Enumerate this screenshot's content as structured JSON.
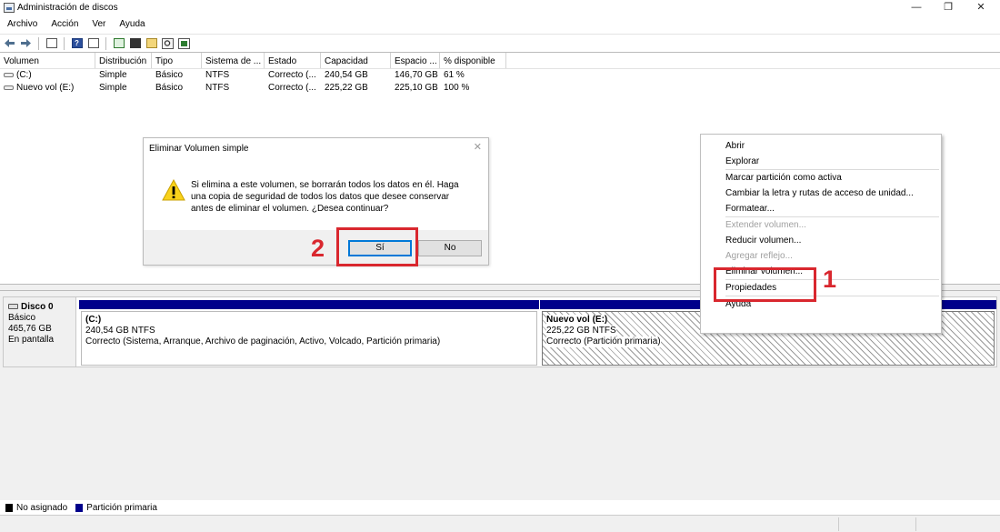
{
  "window": {
    "title": "Administración de discos",
    "minimize": "—",
    "maximize": "❐",
    "close": "✕"
  },
  "menu": [
    "Archivo",
    "Acción",
    "Ver",
    "Ayuda"
  ],
  "toolbar_icons": [
    "back-arrow-icon",
    "forward-arrow-icon",
    "console-tree-icon",
    "help-icon",
    "properties-icon",
    "refresh-icon",
    "disk-icon",
    "open-folder-icon",
    "search-icon",
    "settings-icon"
  ],
  "volume_table": {
    "columns": [
      "Volumen",
      "Distribución",
      "Tipo",
      "Sistema de ...",
      "Estado",
      "Capacidad",
      "Espacio ...",
      "% disponible"
    ],
    "rows": [
      [
        "(C:)",
        "Simple",
        "Básico",
        "NTFS",
        "Correcto (...",
        "240,54 GB",
        "146,70 GB",
        "61 %"
      ],
      [
        "Nuevo vol (E:)",
        "Simple",
        "Básico",
        "NTFS",
        "Correcto (...",
        "225,22 GB",
        "225,10 GB",
        "100 %"
      ]
    ]
  },
  "disk": {
    "name": "Disco 0",
    "type": "Básico",
    "size": "465,76 GB",
    "status": "En pantalla",
    "partitions": [
      {
        "name": "(C:)",
        "size": "240,54 GB NTFS",
        "status": "Correcto (Sistema, Arranque, Archivo de paginación, Activo, Volcado, Partición primaria)"
      },
      {
        "name": "Nuevo vol  (E:)",
        "size": "225,22 GB NTFS",
        "status": "Correcto (Partición primaria)"
      }
    ]
  },
  "legend": {
    "unassigned": "No asignado",
    "primary": "Partición primaria",
    "colors": {
      "unassigned": "#000000",
      "primary": "#00008b"
    }
  },
  "dialog": {
    "title": "Eliminar Volumen simple",
    "message": "Si elimina a este volumen, se borrarán todos los datos en él. Haga una copia de seguridad de todos los datos que desee conservar antes de eliminar el volumen. ¿Desea continuar?",
    "yes": "Sí",
    "no": "No",
    "close": "✕"
  },
  "context_menu": {
    "items": [
      {
        "label": "Abrir",
        "enabled": true
      },
      {
        "label": "Explorar",
        "enabled": true
      },
      {
        "label": "Marcar partición como activa",
        "enabled": true
      },
      {
        "label": "Cambiar la letra y rutas de acceso de unidad...",
        "enabled": true
      },
      {
        "label": "Formatear...",
        "enabled": true
      },
      {
        "label": "Extender volumen...",
        "enabled": false
      },
      {
        "label": "Reducir volumen...",
        "enabled": true
      },
      {
        "label": "Agregar reflejo...",
        "enabled": false
      },
      {
        "label": "Eliminar volumen...",
        "enabled": true
      },
      {
        "label": "Propiedades",
        "enabled": true
      },
      {
        "label": "Ayuda",
        "enabled": true
      }
    ]
  },
  "annotations": {
    "step1": "1",
    "step2": "2",
    "color": "#d9272e"
  }
}
